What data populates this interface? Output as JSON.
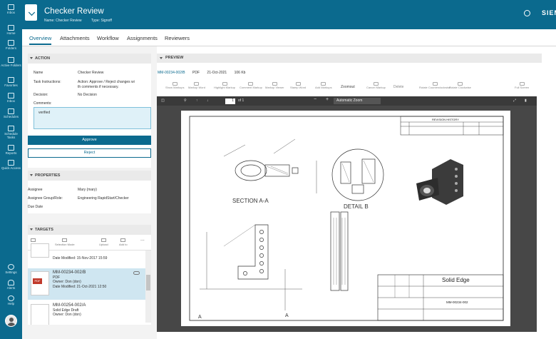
{
  "app": {
    "brand": "SIEMENS",
    "title": "Checker Review",
    "name_line": "Name: Checker Review",
    "type_line": "Type: Signoff",
    "accent": "#0b6a8e"
  },
  "nav": [
    {
      "label": "Inbox",
      "icon": "inbox-icon"
    },
    {
      "label": "Home",
      "icon": "home-icon"
    },
    {
      "label": "Folders",
      "icon": "folder-icon"
    },
    {
      "label": "Active Folders",
      "icon": "active-folder-icon"
    },
    {
      "label": "Favorites",
      "icon": "star-icon"
    },
    {
      "label": "Inbox",
      "icon": "inbox-tray-icon"
    },
    {
      "label": "Schedules",
      "icon": "calendar-icon"
    },
    {
      "label": "Schedule Tasks",
      "icon": "schedule-task-icon"
    },
    {
      "label": "Reports",
      "icon": "report-icon"
    },
    {
      "label": "Quick Access",
      "icon": "quick-access-icon"
    },
    {
      "label": "Settings",
      "icon": "gear-icon"
    },
    {
      "label": "Alerts",
      "icon": "bell-icon"
    },
    {
      "label": "Help",
      "icon": "help-icon"
    }
  ],
  "tabs": [
    "Overview",
    "Attachments",
    "Workflow",
    "Assignments",
    "Reviewers"
  ],
  "action": {
    "heading": "ACTION",
    "name_label": "Name",
    "name_value": "Checker Review",
    "instructions_label": "Task Instructions:",
    "instructions_value": "Action: Approve / Reject changes wi",
    "instructions_value2": "th comments if necessary.",
    "decision_label": "Decision:",
    "decision_value": "No Decision",
    "comments_label": "Comments:",
    "comments_value": "verified",
    "approve": "Approve",
    "reject": "Reject"
  },
  "properties": {
    "heading": "PROPERTIES",
    "assignee_label": "Assignee",
    "assignee_value": "Mary (mary)",
    "group_label": "Assignee Group/Role:",
    "group_value": "Engineering RapidStart/Checker",
    "due_label": "Due Date"
  },
  "targets": {
    "heading": "TARGETS",
    "tools": [
      "List",
      "Selection Mode",
      "Upload",
      "Add to",
      "..."
    ],
    "items": [
      {
        "line1": "Date Modified: 15-Nov-2017 15:59",
        "line2": "",
        "line3": "",
        "line4": ""
      },
      {
        "line1": "MM-00234-002/B",
        "line2": "PDF",
        "line3": "Owner: Don (don)",
        "line4": "Date Modified: 21-Oct-2021 12:50",
        "badge": "PDF"
      },
      {
        "line1": "MM-00254-002/A",
        "line2": "Solid Edge Draft",
        "line3": "Owner: Don (don)",
        "line4": ""
      }
    ]
  },
  "preview": {
    "heading": "PREVIEW",
    "file_name": "MM-00234-002/B",
    "file_type": "PDF",
    "file_date": "21-Oct-2021",
    "file_size": "106 Kb",
    "tools": [
      "Show Markups",
      "Markup Word",
      "Highlight Markup",
      "Comment Markup",
      "Markup Viewer",
      "Stamp Word",
      "Add Markups",
      "Zoomout",
      "Cancel Markup",
      "Delete",
      "Rotate Counterclockwise",
      "Rotate Clockwise",
      "Full Screen"
    ],
    "page_num": "1",
    "page_of": "of 1",
    "zoom": "Automatic Zoom",
    "drawing": {
      "section_label": "SECTION A-A",
      "detail_label": "DETAIL B",
      "title_block": "Solid Edge",
      "part_no": "MM-00234-002",
      "revision_history": "REVISION HISTORY",
      "zone_label": "A",
      "rev_label": "A"
    }
  }
}
